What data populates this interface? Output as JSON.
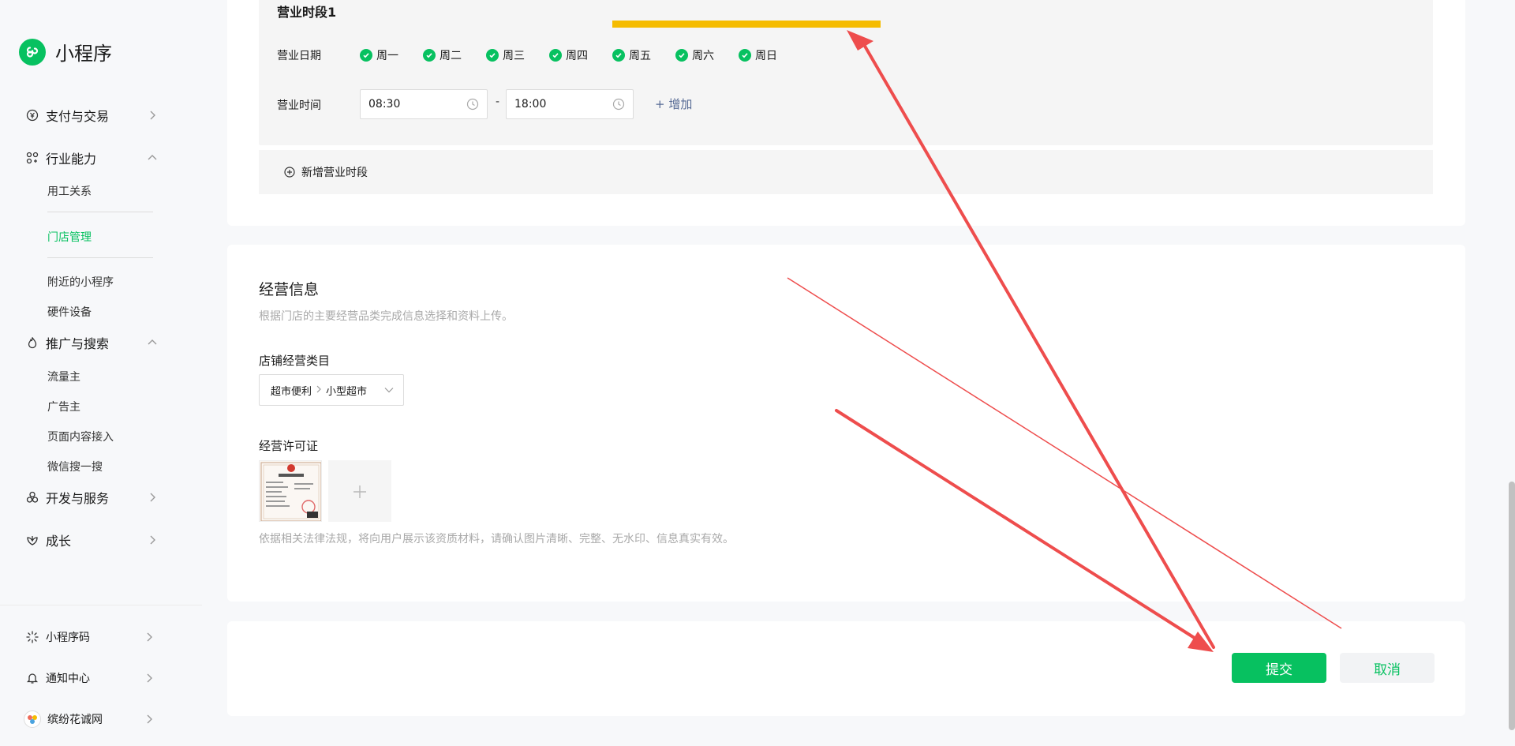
{
  "sidebar": {
    "brand": "小程序",
    "items": [
      {
        "label": "支付与交易",
        "icon": "currency-icon",
        "expanded": false
      },
      {
        "label": "行业能力",
        "icon": "industry-icon",
        "expanded": true
      },
      {
        "label": "推广与搜索",
        "icon": "flame-icon",
        "expanded": true
      },
      {
        "label": "开发与服务",
        "icon": "dev-icon",
        "expanded": false
      },
      {
        "label": "成长",
        "icon": "growth-icon",
        "expanded": false
      }
    ],
    "industry_sub": [
      "用工关系",
      "门店管理",
      "附近的小程序",
      "硬件设备"
    ],
    "promo_sub": [
      "流量主",
      "广告主",
      "页面内容接入",
      "微信搜一搜"
    ],
    "bottom": [
      {
        "label": "小程序码",
        "icon": "qrcode-icon"
      },
      {
        "label": "通知中心",
        "icon": "bell-icon"
      },
      {
        "label": "缤纷花诚网",
        "icon": "avatar-icon"
      }
    ],
    "active_sub": "门店管理"
  },
  "hours": {
    "period_title": "营业时段1",
    "date_label": "营业日期",
    "days": [
      "周一",
      "周二",
      "周三",
      "周四",
      "周五",
      "周六",
      "周日"
    ],
    "time_label": "营业时间",
    "start_time": "08:30",
    "dash": "-",
    "end_time": "18:00",
    "add_link": "+ 增加",
    "new_period": "新增营业时段"
  },
  "business": {
    "title": "经营信息",
    "desc": "根据门店的主要经营品类完成信息选择和资料上传。",
    "category_label": "店铺经营类目",
    "category_level1": "超市便利",
    "category_level2": "小型超市",
    "license_label": "经营许可证",
    "license_note": "依据相关法律法规，将向用户展示该资质材料，请确认图片清晰、完整、无水印、信息真实有效。"
  },
  "actions": {
    "submit": "提交",
    "cancel": "取消"
  },
  "colors": {
    "brand_green": "#07c160",
    "annotation_red": "#ee4d4d",
    "highlight_yellow": "#f5bc00",
    "link_blue": "#576b95"
  }
}
